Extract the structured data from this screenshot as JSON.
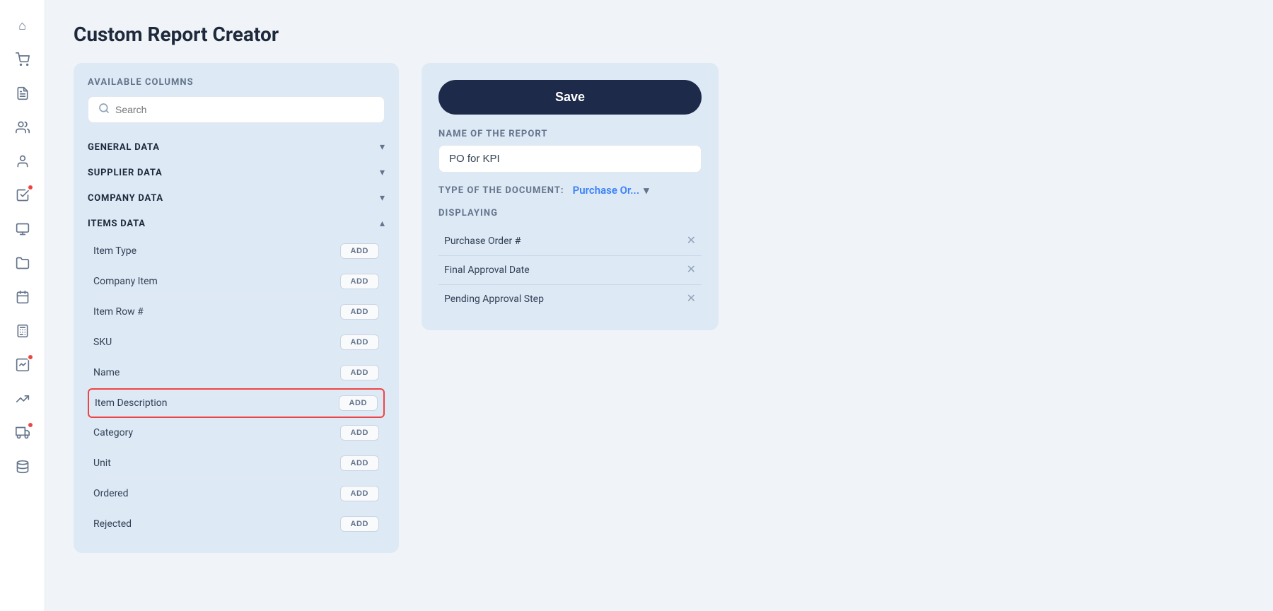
{
  "page": {
    "title": "Custom Report Creator"
  },
  "sidebar": {
    "icons": [
      {
        "name": "home-icon",
        "symbol": "⌂"
      },
      {
        "name": "shopping-cart-icon",
        "symbol": "🛒"
      },
      {
        "name": "invoice-icon",
        "symbol": "🧾"
      },
      {
        "name": "users-icon",
        "symbol": "👥"
      },
      {
        "name": "team-icon",
        "symbol": "👤"
      },
      {
        "name": "checklist-icon",
        "symbol": "✅",
        "badge": true
      },
      {
        "name": "reports-icon",
        "symbol": "📊"
      },
      {
        "name": "files-icon",
        "symbol": "📁"
      },
      {
        "name": "calendar-icon",
        "symbol": "📅"
      },
      {
        "name": "calculator-icon",
        "symbol": "🖩"
      },
      {
        "name": "analytics-icon",
        "symbol": "📈",
        "badge": true
      },
      {
        "name": "trend-icon",
        "symbol": "📉"
      },
      {
        "name": "delivery-icon",
        "symbol": "🚚",
        "badge": true
      },
      {
        "name": "database-icon",
        "symbol": "🗄"
      }
    ]
  },
  "columns_panel": {
    "title": "AVAILABLE COLUMNS",
    "search_placeholder": "Search",
    "sections": [
      {
        "label": "GENERAL DATA",
        "expanded": false,
        "items": []
      },
      {
        "label": "SUPPLIER DATA",
        "expanded": false,
        "items": []
      },
      {
        "label": "COMPANY DATA",
        "expanded": false,
        "items": []
      },
      {
        "label": "ITEMS DATA",
        "expanded": true,
        "items": [
          {
            "name": "Item Type",
            "highlighted": false
          },
          {
            "name": "Company Item",
            "highlighted": false
          },
          {
            "name": "Item Row #",
            "highlighted": false
          },
          {
            "name": "SKU",
            "highlighted": false
          },
          {
            "name": "Name",
            "highlighted": false
          },
          {
            "name": "Item Description",
            "highlighted": true
          },
          {
            "name": "Category",
            "highlighted": false
          },
          {
            "name": "Unit",
            "highlighted": false
          },
          {
            "name": "Ordered",
            "highlighted": false
          },
          {
            "name": "Rejected",
            "highlighted": false
          }
        ]
      }
    ],
    "add_label": "ADD"
  },
  "report_panel": {
    "save_label": "Save",
    "name_label": "NAME OF THE REPORT",
    "name_value": "PO for KPI",
    "doc_type_label": "TYPE OF THE DOCUMENT:",
    "doc_type_value": "Purchase Or...",
    "displaying_label": "DISPLAYING",
    "display_items": [
      {
        "name": "Purchase Order #"
      },
      {
        "name": "Final Approval Date"
      },
      {
        "name": "Pending Approval Step"
      }
    ]
  }
}
